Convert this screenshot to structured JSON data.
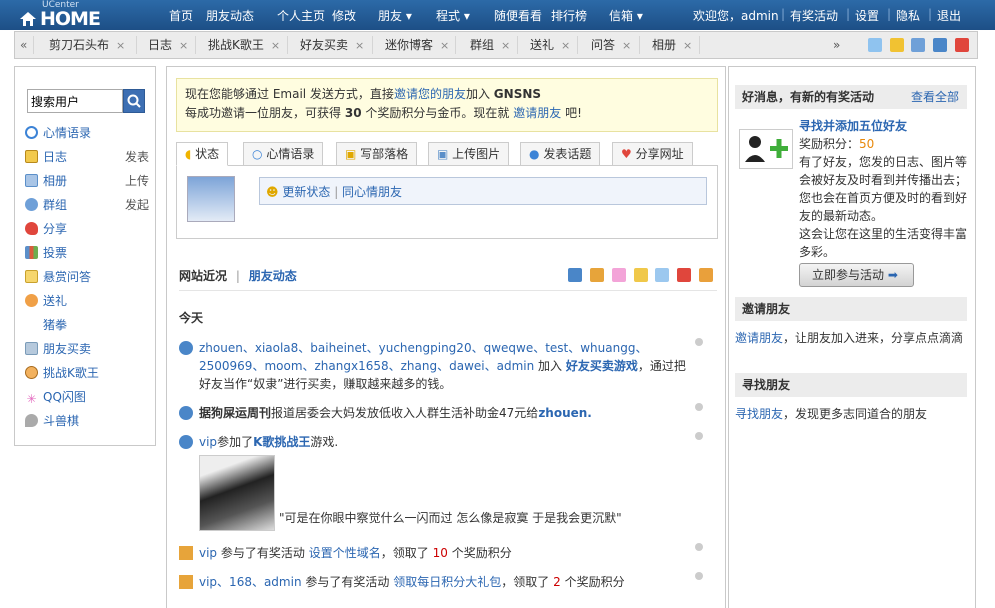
{
  "brand": {
    "top": "UCenter",
    "name": "HOME"
  },
  "topnav": [
    {
      "label": "首页"
    },
    {
      "label": "朋友动态"
    },
    {
      "label": "个人主页"
    },
    {
      "label": "修改"
    },
    {
      "label": "朋友 ▾"
    },
    {
      "label": "程式 ▾"
    },
    {
      "label": "随便看看"
    },
    {
      "label": "排行榜"
    },
    {
      "label": "信箱 ▾"
    }
  ],
  "userbar": {
    "welcome": "欢迎您，admin",
    "links": [
      "有奖活动",
      "设置",
      "隐私",
      "退出"
    ]
  },
  "tabs": [
    "剪刀石头布",
    "日志",
    "挑战K歌王",
    "好友买卖",
    "迷你博客",
    "群组",
    "送礼",
    "问答",
    "相册"
  ],
  "tabbar_more": "»",
  "sidebar": {
    "search_value": "搜索用户",
    "items": [
      {
        "label": "心情语录",
        "icon": "chat-icon",
        "color": "#3c83d6",
        "action": ""
      },
      {
        "label": "日志",
        "icon": "blog-icon",
        "color": "#e9b928",
        "action": "发表"
      },
      {
        "label": "相册",
        "icon": "album-icon",
        "color": "#5b8fc9",
        "action": "上传"
      },
      {
        "label": "群组",
        "icon": "group-icon",
        "color": "#3c83d6",
        "action": "发起"
      },
      {
        "label": "分享",
        "icon": "share-icon",
        "color": "#d9463d",
        "action": ""
      },
      {
        "label": "投票",
        "icon": "poll-icon",
        "color": "#d95d3d",
        "action": ""
      },
      {
        "label": "悬赏问答",
        "icon": "question-icon",
        "color": "#e2b437",
        "action": ""
      },
      {
        "label": "送礼",
        "icon": "gift-icon",
        "color": "#e47f2a",
        "action": ""
      },
      {
        "label": "猪拳",
        "icon": "blank-icon",
        "color": "#ffffff",
        "action": ""
      },
      {
        "label": "朋友买卖",
        "icon": "trade-icon",
        "color": "#7a9bb8",
        "action": ""
      },
      {
        "label": "挑战K歌王",
        "icon": "karaoke-icon",
        "color": "#d98a2b",
        "action": ""
      },
      {
        "label": "QQ闪图",
        "icon": "flash-icon",
        "color": "#e46bc0",
        "action": ""
      },
      {
        "label": "斗兽棋",
        "icon": "chess-icon",
        "color": "#999999",
        "action": ""
      }
    ]
  },
  "invite": {
    "line1_a": "现在您能够通过 Email 发送方式，直接",
    "line1_link": "邀请您的朋友",
    "line1_b": "加入",
    "site": "GNSNS",
    "line2_a": "每成功邀请一位朋友，可获得",
    "points": "30",
    "line2_b": "个奖励积分与金币。现在就",
    "line2_link": "邀请朋友",
    "line2_c": "吧!"
  },
  "post_tabs": [
    "状态",
    "心情语录",
    "写部落格",
    "上传图片",
    "发表话题",
    "分享网址"
  ],
  "post_box": {
    "update": "更新状态",
    "mood": "同心情朋友"
  },
  "feed_header": {
    "title": "网站近况",
    "sep": "|",
    "link": "朋友动态"
  },
  "today": "今天",
  "feed": [
    {
      "names": "zhouen、xiaola8、baiheinet、yuchengping20、qweqwe、test、whuangg、2500969、moom、zhangx1658、zhang、dawei、admin",
      "mid": "加入",
      "link": "好友买卖游戏",
      "tail": "，通过把好友当作“奴隶”进行买卖，赚取越来越多的钱。"
    },
    {
      "lead": "据",
      "bold": "狗屎运周刊",
      "text": "报道居委会大妈发放低收入人群生活补助金47元给",
      "user": "zhouen."
    },
    {
      "user": "vip",
      "a": "参加了",
      "link": "K歌挑战王",
      "b": "游戏.",
      "caption": "\"可是在你眼中察觉什么一闪而过 怎么像是寂寞 于是我会更沉默\""
    },
    {
      "user": "vip",
      "a": "参与了有奖活动",
      "link": "设置个性域名",
      "b": "，领取了",
      "n": "10",
      "c": "个奖励积分"
    },
    {
      "users": "vip、168、admin",
      "a": "参与了有奖活动",
      "link": "领取每日积分大礼包",
      "b": "，领取了",
      "n": "2",
      "c": "个奖励积分"
    }
  ],
  "right": {
    "news_title": "好消息，有新的有奖活动",
    "view_all": "查看全部",
    "task_title": "寻找并添加五位好友",
    "reward_label": "奖励积分：",
    "reward": "50",
    "desc1": "有了好友，您发的日志、图片等会被好友及时看到并传播出去；您也会在首页方便及时的看到好友的最新动态。",
    "desc2": "这会让您在这里的生活变得丰富多彩。",
    "join_btn": "立即参与活动",
    "invite_title": "邀请朋友",
    "invite_link": "邀请朋友",
    "invite_text": "，让朋友加入进来，分享点点滴滴",
    "find_title": "寻找朋友",
    "find_link": "寻找朋友",
    "find_text": "，发现更多志同道合的朋友"
  }
}
